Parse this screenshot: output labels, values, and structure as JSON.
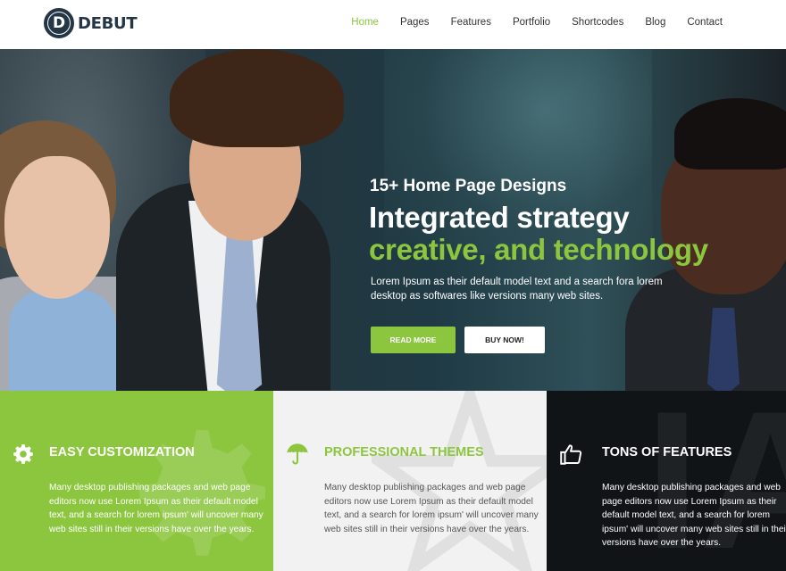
{
  "header": {
    "logo_letter": "D",
    "logo_text": "DEBUT",
    "nav": [
      "Home",
      "Pages",
      "Features",
      "Portfolio",
      "Shortcodes",
      "Blog",
      "Contact"
    ],
    "active_nav": "Home"
  },
  "hero": {
    "subtitle": "15+ Home Page Designs",
    "title_line1": "Integrated strategy",
    "title_line2": "creative, and technology",
    "description": "Lorem Ipsum as their default model text and a search fora lorem desktop as softwares like versions many web sites.",
    "read_more_label": "READ MORE",
    "buy_now_label": "BUY NOW!"
  },
  "features": [
    {
      "title": "EASY CUSTOMIZATION",
      "icon": "gear-icon",
      "text": "Many desktop publishing packages and web page editors now use Lorem Ipsum as their default model text, and a search for lorem ipsum' will uncover many web sites still in their versions have over the years."
    },
    {
      "title": "PROFESSIONAL THEMES",
      "icon": "umbrella-icon",
      "text": "Many desktop publishing packages and web page editors now use Lorem Ipsum as their default model text, and a search for lorem ipsum' will uncover many web sites still in their versions have over the years."
    },
    {
      "title": "TONS OF FEATURES",
      "icon": "thumbs-up-icon",
      "text": "Many desktop publishing packages and web page editors now use Lorem Ipsum as their default model text, and a search for lorem ipsum' will uncover many web sites still in their versions have over the years."
    }
  ],
  "colors": {
    "accent": "#8cc63f",
    "dark": "#111417",
    "light": "#f2f2f2",
    "logo": "#253746"
  }
}
